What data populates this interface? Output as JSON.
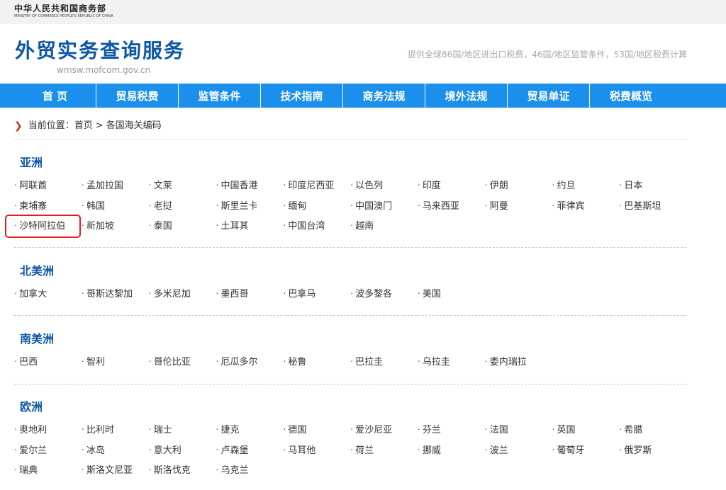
{
  "ministry": {
    "name_cn": "中华人民共和国商务部",
    "name_en": "MINISTRY OF COMMERCE PEOPLE'S REPUBLIC OF CHINA"
  },
  "site": {
    "title": "外贸实务查询服务",
    "url": "wmsw.mofcom.gov.cn",
    "tagline": "提供全球86国/地区进出口税费，46国/地区监管条件，53国/地区税费计算"
  },
  "nav": [
    "首 页",
    "贸易税费",
    "监管条件",
    "技术指南",
    "商务法规",
    "境外法规",
    "贸易单证",
    "税费概览"
  ],
  "breadcrumb": {
    "prefix": "当前位置：",
    "home": "首页",
    "sep": ">",
    "current": "各国海关编码"
  },
  "regions": [
    {
      "title": "亚洲",
      "countries": [
        "阿联酋",
        "孟加拉国",
        "文莱",
        "中国香港",
        "印度尼西亚",
        "以色列",
        "印度",
        "伊朗",
        "约旦",
        "日本",
        "柬埔寨",
        "韩国",
        "老挝",
        "斯里兰卡",
        "缅甸",
        "中国澳门",
        "马来西亚",
        "阿曼",
        "菲律宾",
        "巴基斯坦",
        "沙特阿拉伯",
        "新加坡",
        "泰国",
        "土耳其",
        "中国台湾",
        "越南"
      ]
    },
    {
      "title": "北美洲",
      "countries": [
        "加拿大",
        "哥斯达黎加",
        "多米尼加",
        "墨西哥",
        "巴拿马",
        "波多黎各",
        "美国"
      ]
    },
    {
      "title": "南美洲",
      "countries": [
        "巴西",
        "智利",
        "哥伦比亚",
        "厄瓜多尔",
        "秘鲁",
        "巴拉圭",
        "乌拉圭",
        "委内瑞拉"
      ]
    },
    {
      "title": "欧洲",
      "countries": [
        "奥地利",
        "比利时",
        "瑞士",
        "捷克",
        "德国",
        "爱沙尼亚",
        "芬兰",
        "法国",
        "英国",
        "希腊",
        "爱尔兰",
        "冰岛",
        "意大利",
        "卢森堡",
        "马耳他",
        "荷兰",
        "挪威",
        "波兰",
        "葡萄牙",
        "俄罗斯",
        "瑞典",
        "斯洛文尼亚",
        "斯洛伐克",
        "乌克兰"
      ]
    }
  ],
  "highlighted_country": "沙特阿拉伯",
  "colors": {
    "nav_bg": "#1a8fec",
    "title_blue": "#0d57a6",
    "highlight": "#e02020",
    "breadcrumb_arrow": "#d4261b"
  }
}
